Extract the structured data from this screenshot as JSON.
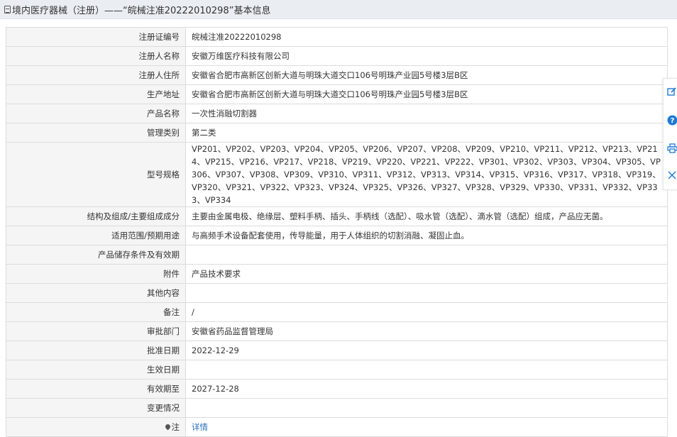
{
  "header": {
    "icon": "document-icon",
    "title": "境内医疗器械（注册）——“皖械注准20222010298”基本信息"
  },
  "rows": [
    {
      "label": "注册证编号",
      "value": "皖械注准20222010298"
    },
    {
      "label": "注册人名称",
      "value": "安徽万维医疗科技有限公司"
    },
    {
      "label": "注册人住所",
      "value": "安徽省合肥市高新区创新大道与明珠大道交口106号明珠产业园5号楼3层B区"
    },
    {
      "label": "生产地址",
      "value": "安徽省合肥市高新区创新大道与明珠大道交口106号明珠产业园5号楼3层B区"
    },
    {
      "label": "产品名称",
      "value": "一次性消融切割器"
    },
    {
      "label": "管理类别",
      "value": "第二类"
    },
    {
      "label": "型号规格",
      "value": "VP201、VP202、VP203、VP204、VP205、VP206、VP207、VP208、VP209、VP210、VP211、VP212、VP213、VP214、VP215、VP216、VP217、VP218、VP219、VP220、VP221、VP222、VP301、VP302、VP303、VP304、VP305、VP306、VP307、VP308、VP309、VP310、VP311、VP312、VP313、VP314、VP315、VP316、VP317、VP318、VP319、VP320、VP321、VP322、VP323、VP324、VP325、VP326、VP327、VP328、VP329、VP330、VP331、VP332、VP333、VP334"
    },
    {
      "label": "结构及组成/主要组成成分",
      "value": "主要由金属电极、绝缘层、塑料手柄、插头、手柄线（选配）、吸水管（选配）、滴水管（选配）组成，产品应无菌。"
    },
    {
      "label": "适用范围/预期用途",
      "value": "与高频手术设备配套使用，传导能量，用于人体组织的切割消融、凝固止血。"
    },
    {
      "label": "产品储存条件及有效期",
      "value": ""
    },
    {
      "label": "附件",
      "value": "产品技术要求"
    },
    {
      "label": "其他内容",
      "value": ""
    },
    {
      "label": "备注",
      "value": "/"
    },
    {
      "label": "审批部门",
      "value": "安徽省药品监督管理局"
    },
    {
      "label": "批准日期",
      "value": "2022-12-29"
    },
    {
      "label": "生效日期",
      "value": ""
    },
    {
      "label": "有效期至",
      "value": "2027-12-28"
    },
    {
      "label": "变更情况",
      "value": ""
    },
    {
      "label": "注",
      "value": "详情"
    }
  ],
  "side_tools": [
    "edit-icon",
    "help-icon",
    "print-icon",
    "close-icon"
  ],
  "colors": {
    "link": "#2a6ebb",
    "side_icon": "#1f7ad6",
    "label_bg": "#f5f5f5"
  }
}
